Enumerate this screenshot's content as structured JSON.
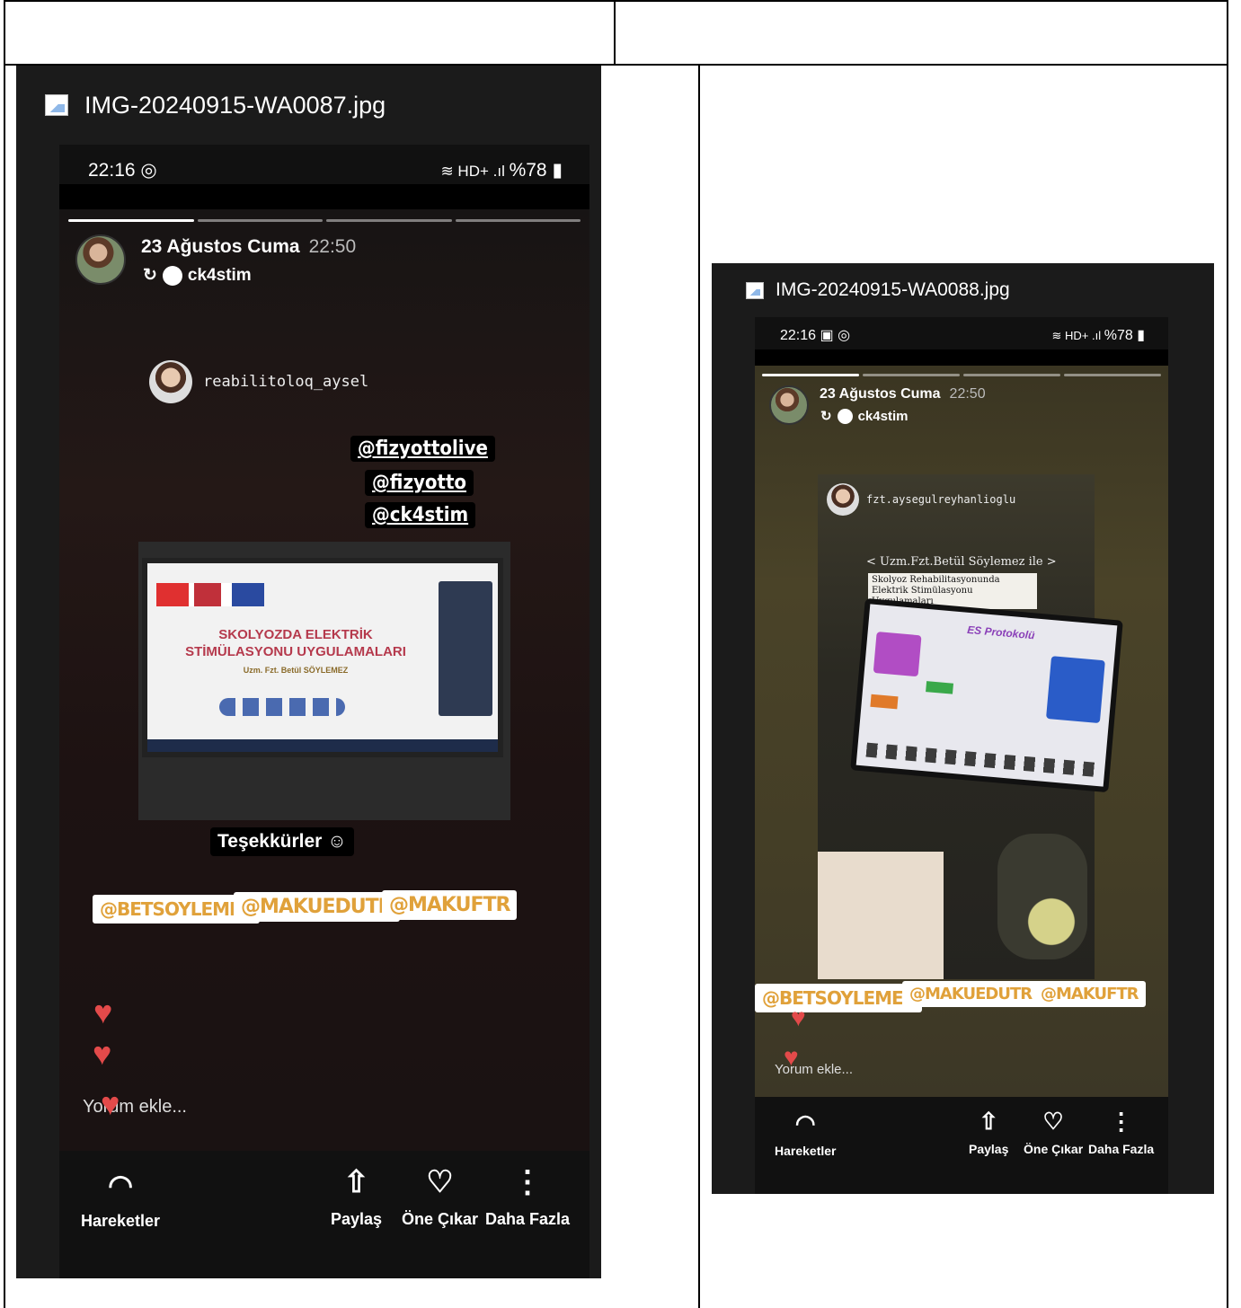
{
  "left": {
    "filename": "IMG-20240915-WA0087.jpg",
    "status": {
      "time": "22:16",
      "right": "%78"
    },
    "story": {
      "date": "23 Ağustos Cuma",
      "time": "22:50",
      "username": "ck4stim",
      "mentioned_user": "reabilitoloq_aysel",
      "tags": [
        "@fizyottolive",
        "@fizyotto",
        "@ck4stim"
      ],
      "slide_title_line1": "SKOLYOZDA ELEKTRİK",
      "slide_title_line2": "STİMÜLASYONU UYGULAMALARI",
      "slide_speaker": "Uzm. Fzt. Betül SÖYLEMEZ",
      "thanks": "Teşekkürler",
      "sticker_tags": [
        "@BETSOYLEMEZ",
        "@MAKUEDUTR",
        "@MAKUFTR"
      ],
      "comment_placeholder": "Yorum ekle..."
    },
    "bottom": [
      "Hareketler",
      "Paylaş",
      "Öne Çıkar",
      "Daha Fazla"
    ]
  },
  "right": {
    "filename": "IMG-20240915-WA0088.jpg",
    "status": {
      "time": "22:16",
      "right": "%78"
    },
    "story": {
      "date": "23 Ağustos Cuma",
      "time": "22:50",
      "username": "ck4stim",
      "mentioned_user": "fzt.aysegulreyhanlioglu",
      "caption_line1": "< Uzm.Fzt.Betül Söylemez ile >",
      "caption_line2": "Skolyoz Rehabilitasyonunda Elektrik Stimülasyonu Uygulamaları",
      "slide_heading": "ES Protokolü",
      "sticker_tags": [
        "@BETSOYLEMEZ",
        "@MAKUEDUTR",
        "@MAKUFTR"
      ],
      "comment_placeholder": "Yorum ekle..."
    },
    "bottom": [
      "Hareketler",
      "Paylaş",
      "Öne Çıkar",
      "Daha Fazla"
    ]
  }
}
